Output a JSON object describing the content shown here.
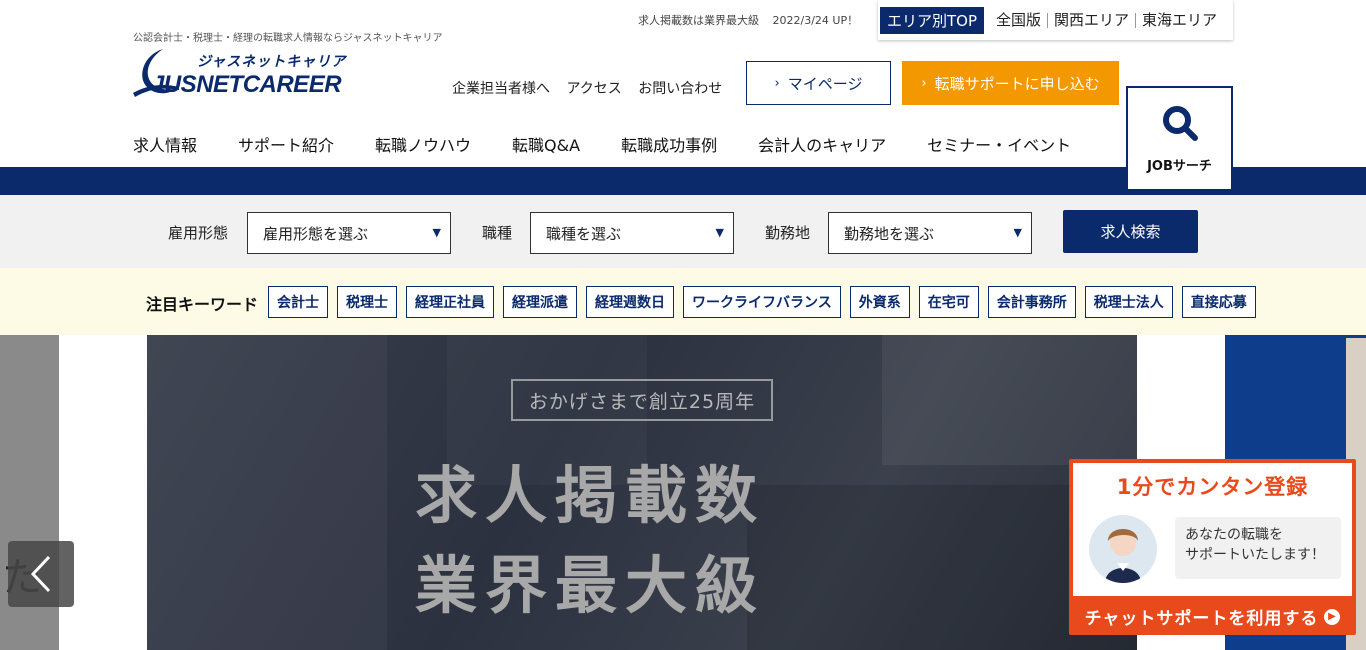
{
  "header": {
    "tagline": "公認会計士・税理士・経理の転職求人情報ならジャスネットキャリア",
    "logo_kana": "ジャスネットキャリア",
    "logo_en": "JUSNETCAREER",
    "info_count": "求人掲載数は業界最大級",
    "info_update": "2022/3/24 UP！",
    "area_top": "エリア別TOP",
    "area_links": [
      "全国版",
      "関西エリア",
      "東海エリア"
    ],
    "sub_links": [
      "企業担当者様へ",
      "アクセス",
      "お問い合わせ"
    ],
    "mypage_label": "マイページ",
    "apply_label": "転職サポートに申し込む",
    "job_search_label": "JOBサーチ"
  },
  "nav": {
    "items": [
      "求人情報",
      "サポート紹介",
      "転職ノウハウ",
      "転職Q&A",
      "転職成功事例",
      "会計人のキャリア",
      "セミナー・イベント"
    ]
  },
  "search": {
    "employment_label": "雇用形態",
    "employment_value": "雇用形態を選ぶ",
    "job_label": "職種",
    "job_value": "職種を選ぶ",
    "location_label": "勤務地",
    "location_value": "勤務地を選ぶ",
    "button_label": "求人検索"
  },
  "keywords": {
    "title": "注目キーワード",
    "items": [
      "会計士",
      "税理士",
      "経理正社員",
      "経理派遣",
      "経理週数日",
      "ワークライフバランス",
      "外資系",
      "在宅可",
      "会計事務所",
      "税理士法人",
      "直接応募"
    ]
  },
  "hero": {
    "badge": "おかげさまで創立25周年",
    "line1": "求人掲載数",
    "line2": "業界最大級",
    "prev_icon": "chevron-left-icon",
    "left_peek_text": "た"
  },
  "chat": {
    "title": "1分でカンタン登録",
    "bubble_line1": "あなたの転職を",
    "bubble_line2": "サポートいたします！",
    "cta": "チャットサポートを利用する"
  },
  "colors": {
    "brand_navy": "#0a2a6b",
    "apply_orange": "#f39800",
    "chat_red": "#e84a1c"
  }
}
